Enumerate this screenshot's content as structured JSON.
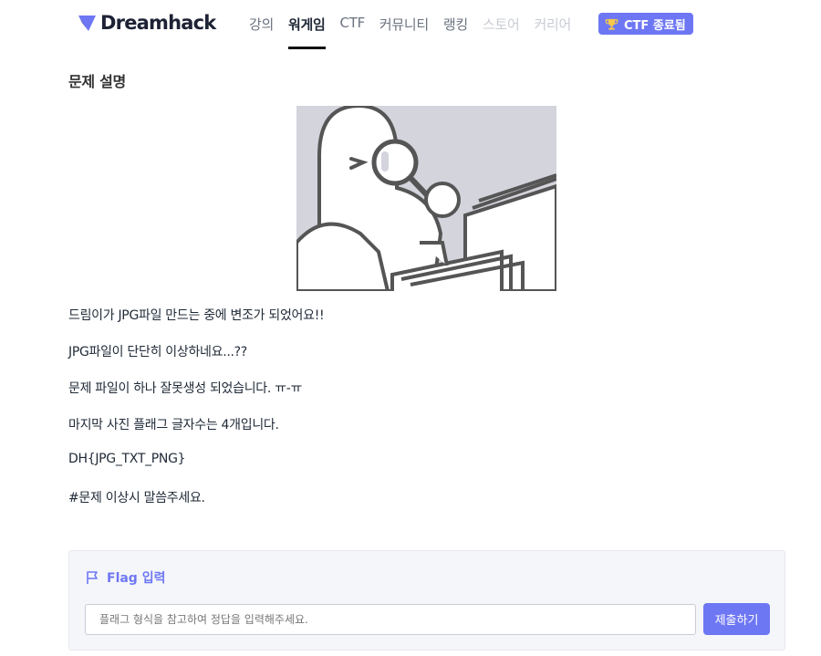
{
  "header": {
    "logo_text": "Dreamhack",
    "nav_items": [
      {
        "label": "강의"
      },
      {
        "label": "워게임"
      },
      {
        "label": "CTF"
      },
      {
        "label": "커뮤니티"
      },
      {
        "label": "랭킹"
      },
      {
        "label": "스토어"
      },
      {
        "label": "커리어"
      }
    ],
    "ctf_badge": "CTF 종료됨",
    "accent_color": "#6e77f3"
  },
  "problem": {
    "section_title": "문제 설명",
    "lines": [
      "드림이가 JPG파일 만드는 중에 변조가 되었어요!!",
      "JPG파일이 단단히 이상하네요...??",
      "문제 파일이 하나 잘못생성 되었습니다. ㅠ-ㅠ",
      "마지막 사진 플래그 글자수는 4개입니다.",
      "DH{JPG_TXT_PNG}",
      "#문제 이상시 말씀주세요."
    ]
  },
  "flag": {
    "title": "Flag 입력",
    "input_placeholder": "플래그 형식을 참고하여 정답을 입력해주세요.",
    "input_value": "",
    "submit_label": "제출하기"
  }
}
